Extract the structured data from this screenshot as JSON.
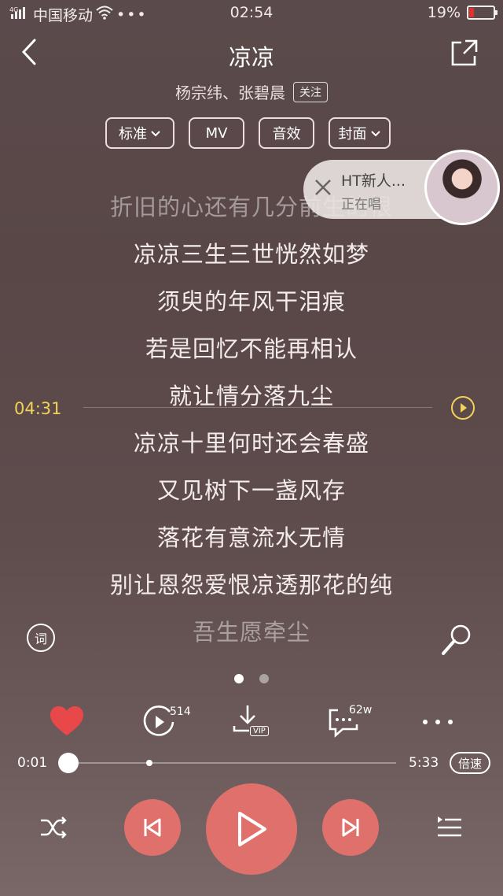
{
  "status_bar": {
    "network": "4G",
    "carrier": "中国移动",
    "time": "02:54",
    "battery": "19%",
    "battery_level": 0.19,
    "icons": [
      "signal-icon",
      "wifi-icon",
      "more-dots-icon",
      "battery-icon"
    ]
  },
  "header": {
    "title": "凉凉",
    "artists": "杨宗纬、张碧晨",
    "follow_label": "关注",
    "icons": [
      "back-arrow-icon",
      "share-icon"
    ]
  },
  "options": {
    "quality": "标准",
    "mv": "MV",
    "effect": "音效",
    "cover": "封面"
  },
  "live_bubble": {
    "name": "HT新人...",
    "status": "正在唱"
  },
  "lyrics": [
    {
      "text": "折旧的心还有几分前生的恨",
      "dim": true
    },
    {
      "text": "凉凉三生三世恍然如梦",
      "dim": false
    },
    {
      "text": "须臾的年风干泪痕",
      "dim": false
    },
    {
      "text": "若是回忆不能再相认",
      "dim": false
    },
    {
      "text": "就让情分落九尘",
      "dim": false
    },
    {
      "text": "凉凉十里何时还会春盛",
      "dim": false
    },
    {
      "text": "又见树下一盏风存",
      "dim": false
    },
    {
      "text": "落花有意流水无情",
      "dim": false
    },
    {
      "text": "别让恩怨爱恨凉透那花的纯",
      "dim": false
    },
    {
      "text": "吾生愿牵尘",
      "dim": true
    }
  ],
  "lyric_time": "04:31",
  "lyric_button": "词",
  "pager": {
    "count": 2,
    "active": 0
  },
  "actions": {
    "play_count": "514",
    "comment_count": "62w",
    "download_badge": "VIP"
  },
  "progress": {
    "current": "0:01",
    "total": "5:33",
    "speed_label": "倍速",
    "fraction": 0.003
  },
  "colors": {
    "accent": "#e0706c",
    "lyric_highlight": "#f2d35a",
    "like": "#e8484a"
  }
}
